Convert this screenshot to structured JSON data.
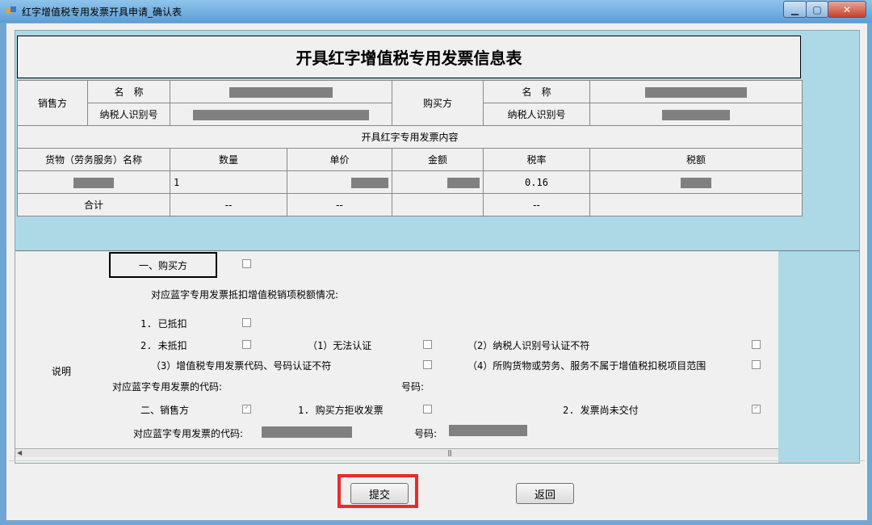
{
  "window": {
    "title": "红字增值税专用发票开具申请_确认表",
    "min": "▁",
    "max": "▢",
    "close": "✕"
  },
  "form_title": "开具红字增值税专用发票信息表",
  "seller": {
    "label": "销售方",
    "name_label": "名　称",
    "tax_id_label": "纳税人识别号"
  },
  "buyer": {
    "label": "购买方",
    "name_label": "名　称",
    "tax_id_label": "纳税人识别号"
  },
  "content_header": "开具红字专用发票内容",
  "columns": [
    "货物（劳务服务）名称",
    "数量",
    "单价",
    "金额",
    "税率",
    "税额"
  ],
  "row": {
    "quantity": "1",
    "tax_rate": "0.16"
  },
  "total": {
    "label": "合计",
    "quantity": "--",
    "unit_price": "--",
    "tax_rate": "--"
  },
  "explain": {
    "label": "说明",
    "buyer_section": "一、购买方",
    "deduction_question": "对应蓝字专用发票抵扣增值税销项税额情况:",
    "deducted": "1. 已抵扣",
    "not_deducted": "2. 未抵扣",
    "reason1": "（1）无法认证",
    "reason2": "（2）纳税人识别号认证不符",
    "reason3": "（3）增值税专用发票代码、号码认证不符",
    "reason4": "（4）所购货物或劳务、服务不属于增值税扣税项目范围",
    "blue_code": "对应蓝字专用发票的代码:",
    "number": "号码:",
    "seller_section": "二、销售方",
    "buyer_rejected": "1. 购买方拒收发票",
    "not_delivered": "2. 发票尚未交付",
    "blue_code2": "对应蓝字专用发票的代码:",
    "number2": "号码:"
  },
  "buttons": {
    "submit": "提交",
    "back": "返回"
  }
}
